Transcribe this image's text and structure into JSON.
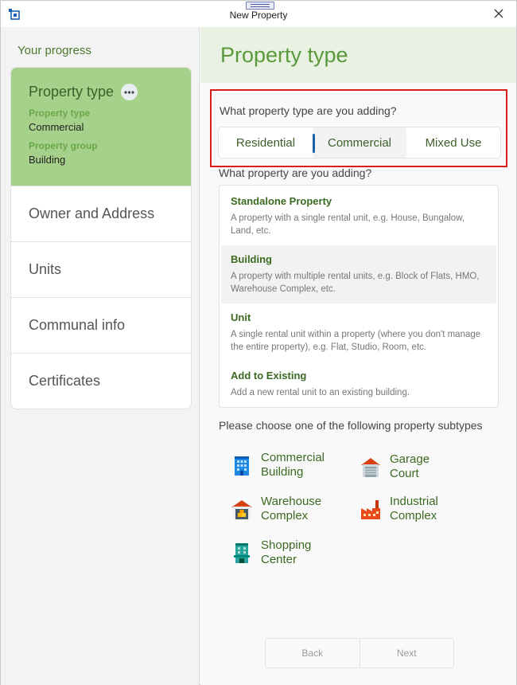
{
  "window": {
    "title": "New Property"
  },
  "sidebar": {
    "heading": "Your progress",
    "active_step": {
      "title": "Property type",
      "fields": [
        {
          "label": "Property type",
          "value": "Commercial"
        },
        {
          "label": "Property group",
          "value": "Building"
        }
      ]
    },
    "steps": [
      "Owner and Address",
      "Units",
      "Communal info",
      "Certificates"
    ]
  },
  "main": {
    "title": "Property type",
    "question1": "What property type are you adding?",
    "segments": [
      "Residential",
      "Commercial",
      "Mixed Use"
    ],
    "selected_segment": "Commercial",
    "question2": "What property are you adding?",
    "property_kinds": [
      {
        "title": "Standalone Property",
        "desc": "A property with a single rental unit, e.g. House, Bungalow, Land, etc."
      },
      {
        "title": "Building",
        "desc": "A property with multiple rental units, e.g. Block of Flats, HMO, Warehouse Complex, etc."
      },
      {
        "title": "Unit",
        "desc": "A single rental unit within a property (where you don't manage the entire property), e.g. Flat, Studio, Room, etc."
      },
      {
        "title": "Add to Existing",
        "desc": "Add a new rental unit to an existing building."
      }
    ],
    "subtype_prompt": "Please choose one of the following property subtypes",
    "subtypes": [
      {
        "name": "Commercial Building",
        "icon": "office-building-icon"
      },
      {
        "name": "Garage Court",
        "icon": "garage-icon"
      },
      {
        "name": "Warehouse Complex",
        "icon": "warehouse-icon"
      },
      {
        "name": "Industrial Complex",
        "icon": "factory-icon"
      },
      {
        "name": "Shopping Center",
        "icon": "shopping-center-icon"
      }
    ]
  },
  "footer": {
    "back": "Back",
    "next": "Next"
  },
  "colors": {
    "accent_green": "#5a9a3b",
    "active_step_bg": "#a6d18a",
    "highlight_red": "#d9201f",
    "selected_indicator": "#1a5fb4"
  }
}
